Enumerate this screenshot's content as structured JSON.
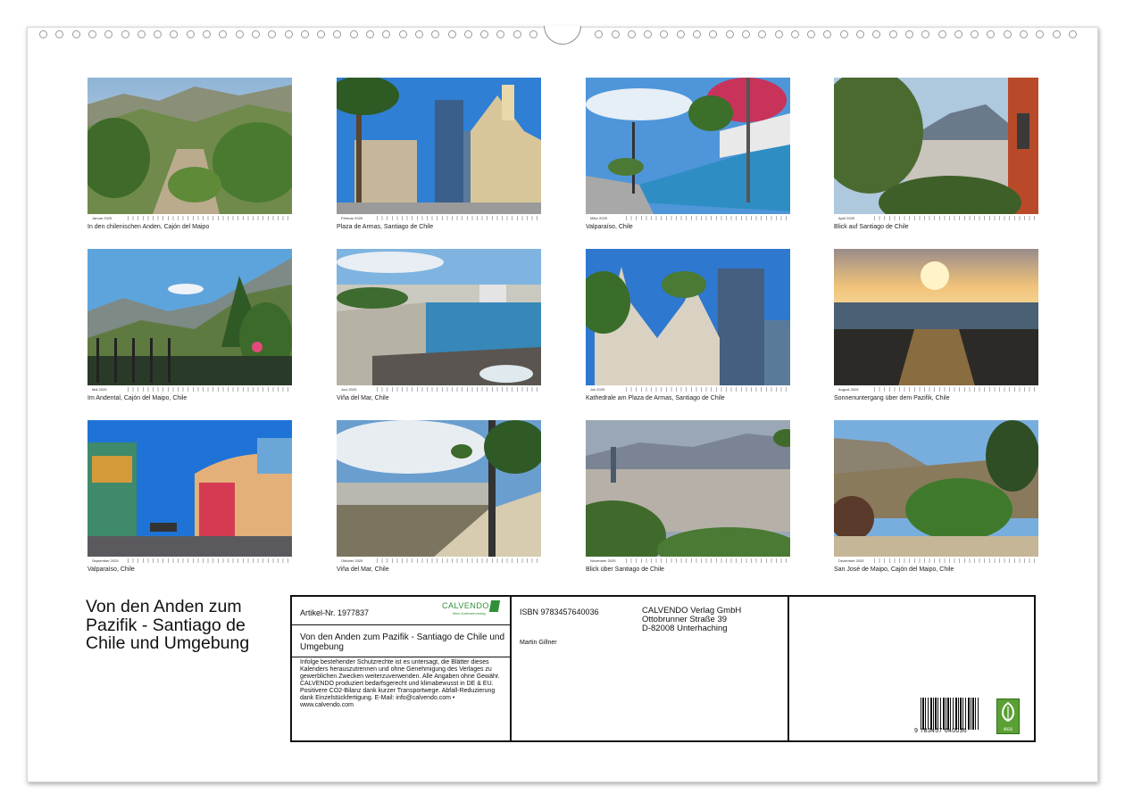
{
  "months": [
    {
      "strip": "Januar 2025",
      "caption": "In den chilenischen Anden, Cajón del Maipo"
    },
    {
      "strip": "Februar 2025",
      "caption": "Plaza de Armas, Santiago de Chile"
    },
    {
      "strip": "März 2025",
      "caption": "Valparaíso, Chile"
    },
    {
      "strip": "April 2025",
      "caption": "Blick auf Santiago de Chile"
    },
    {
      "strip": "Mai 2025",
      "caption": "Im Andental, Cajón del Maipo, Chile"
    },
    {
      "strip": "Juni 2025",
      "caption": "Viña del Mar, Chile"
    },
    {
      "strip": "Juli 2025",
      "caption": "Kathedrale am Plaza de Armas, Santiago de Chile"
    },
    {
      "strip": "August 2025",
      "caption": "Sonnenuntergang über dem Pazifik, Chile"
    },
    {
      "strip": "September 2025",
      "caption": "Valparaíso, Chile"
    },
    {
      "strip": "Oktober 2025",
      "caption": "Viña del Mar, Chile"
    },
    {
      "strip": "November 2025",
      "caption": "Blick über Santiago de Chile"
    },
    {
      "strip": "Dezember 2025",
      "caption": "San José de Maipo, Cajón del Maipo, Chile"
    }
  ],
  "title": "Von den Anden zum Pazifik - Santiago de Chile und Umgebung",
  "info": {
    "article": "Artikel-Nr. 1977837",
    "brand": "CALVENDO",
    "brand_sub": "Mein Kalenderverlag",
    "product_title": "Von den Anden zum Pazifik - Santiago de Chile und Umgebung",
    "legal": "Infolge bestehender Schutzrechte ist es untersagt, die Blätter dieses Kalenders herauszutrennen und ohne Genehmigung des Verlages zu gewerblichen Zwecken weiterzuverwenden. Alle Angaben ohne Gewähr. CALVENDO produziert bedarfsgerecht und klimabewusst in DE & EU. Positivere CO2-Bilanz dank kurzer Transportwege. Abfall-Reduzierung dank Einzelstückfertigung. E-Mail: info@calvendo.com • www.calvendo.com",
    "isbn": "ISBN 9783457640036",
    "author": "Martin Gillner",
    "publisher": "CALVENDO Verlag GmbH",
    "street": "Ottobrunner Straße 39",
    "city": "D-82008 Unterhaching",
    "barcode_number": "9 783457 640036",
    "eco_label": "eco"
  },
  "colors": {
    "brand_green": "#2f8f3a",
    "eco_green": "#5aa034"
  }
}
